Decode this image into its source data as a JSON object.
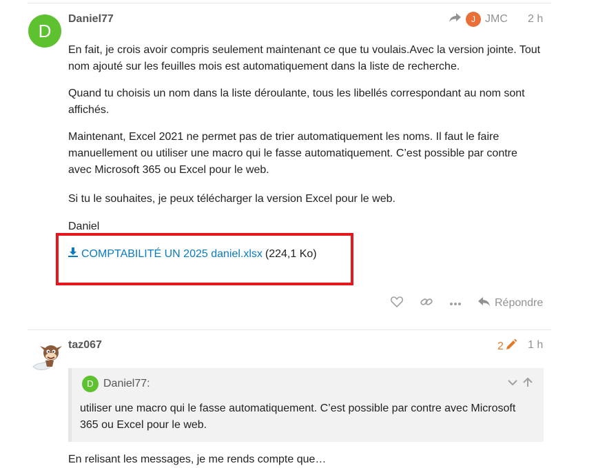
{
  "post1": {
    "avatar_letter": "D",
    "username": "Daniel77",
    "reply_to_letter": "J",
    "reply_to_name": "JMC",
    "time": "2 h",
    "paragraphs": [
      "En fait, je crois avoir compris seulement maintenant ce que tu voulais.Avec la version jointe. Tout nom ajouté sur les feuilles mois est automatiquement dans la liste de recherche.",
      "Quand tu choisis un nom dans la liste déroulante, tous les libellés correspondant au nom sont affichés.",
      "Maintenant, Excel 2021 ne permet pas de trier automatiquement les noms. Il faut le faire manuellement ou utiliser une macro qui le fasse automatiquement. C’est possible par contre avec Microsoft 365 ou Excel pour le web.",
      "Si tu le souhaites, je peux télécharger la version Excel pour le web.",
      "Daniel"
    ],
    "attachment": {
      "name": "COMPTABILITÉ UN 2025 daniel.xlsx",
      "size": "(224,1 Ko)"
    },
    "actions": {
      "reply_label": "Répondre"
    }
  },
  "post2": {
    "username": "taz067",
    "edits_count": "2",
    "time": "1 h",
    "quote": {
      "avatar_letter": "D",
      "author": "Daniel77:",
      "text": "utiliser une macro qui le fasse automatiquement. C’est possible par contre avec Microsoft 365 ou Excel pour le web."
    },
    "partial_text": "En relisant les messages, je me rends compte que…"
  },
  "colors": {
    "avatar_green": "#5dc130",
    "avatar_orange": "#e86f3a",
    "link_blue": "#0a7bbf",
    "highlight_red": "#e5161c",
    "edit_orange": "#e07a2b",
    "muted": "#929292"
  }
}
